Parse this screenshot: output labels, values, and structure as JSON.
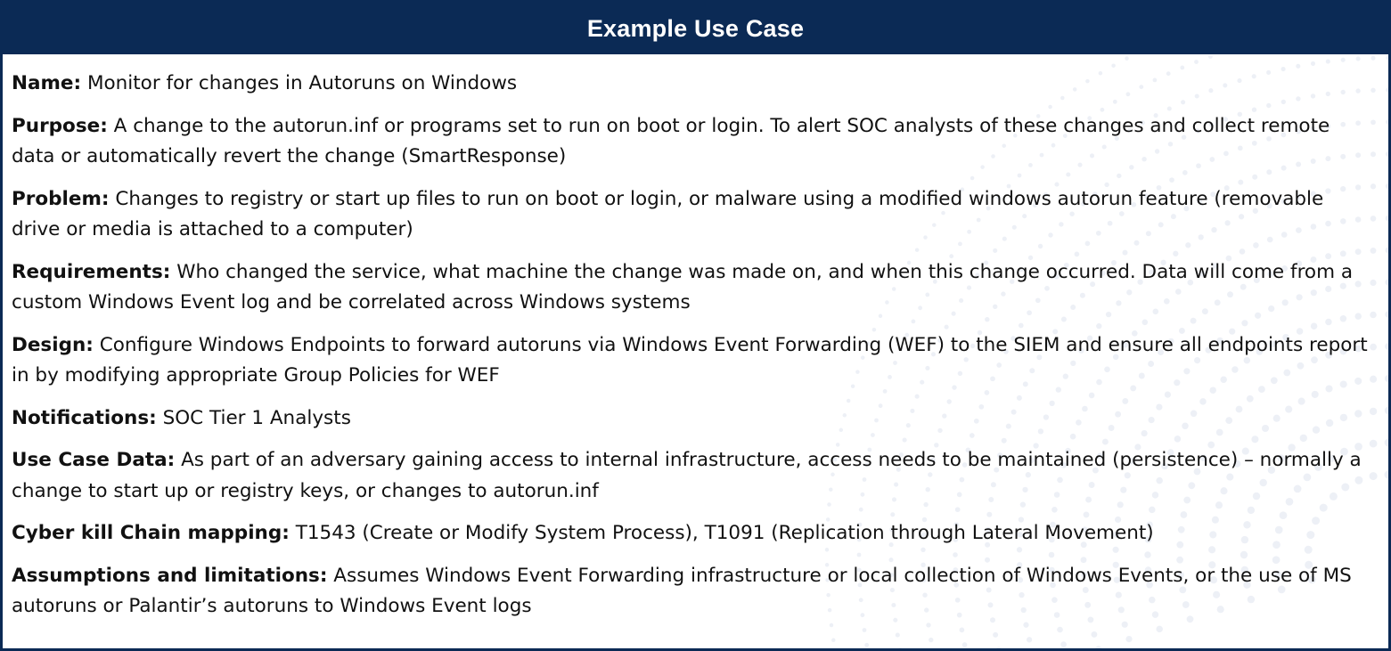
{
  "header": {
    "title": "Example Use Case"
  },
  "colors": {
    "header_bg": "#0b2a55",
    "border": "#0b2a55",
    "text": "#111111"
  },
  "rows": [
    {
      "label": "Name:",
      "text": "Monitor for changes in Autoruns on Windows"
    },
    {
      "label": "Purpose:",
      "text": "A change to the autorun.inf or programs set to run on boot or login. To alert SOC analysts of these changes and collect remote data or automatically revert the change (SmartResponse)"
    },
    {
      "label": "Problem:",
      "text": "Changes to registry or start up files to run on boot or login, or malware using a modified windows autorun feature (removable drive or media is attached to a computer)"
    },
    {
      "label": "Requirements:",
      "text": "Who changed the service, what machine the change was made on, and when this change occurred. Data will come from a custom Windows Event log and be correlated across Windows systems"
    },
    {
      "label": "Design:",
      "text": "Configure Windows Endpoints to forward autoruns via Windows Event Forwarding (WEF) to the SIEM and ensure all endpoints report in by modifying appropriate Group Policies for WEF"
    },
    {
      "label": "Notifications:",
      "text": "SOC Tier 1 Analysts"
    },
    {
      "label": "Use Case Data:",
      "text": "As part of an adversary gaining access to internal infrastructure, access needs to be maintained (persistence) – normally a change to start up or registry keys, or changes to autorun.inf"
    },
    {
      "label": "Cyber kill Chain mapping:",
      "text": "T1543 (Create or Modify System Process), T1091 (Replication through Lateral Movement)"
    },
    {
      "label": "Assumptions and limitations:",
      "text": "Assumes Windows Event Forwarding infrastructure or local collection of Windows Events, or the use of MS autoruns or Palantir’s autoruns to Windows Event logs"
    }
  ]
}
